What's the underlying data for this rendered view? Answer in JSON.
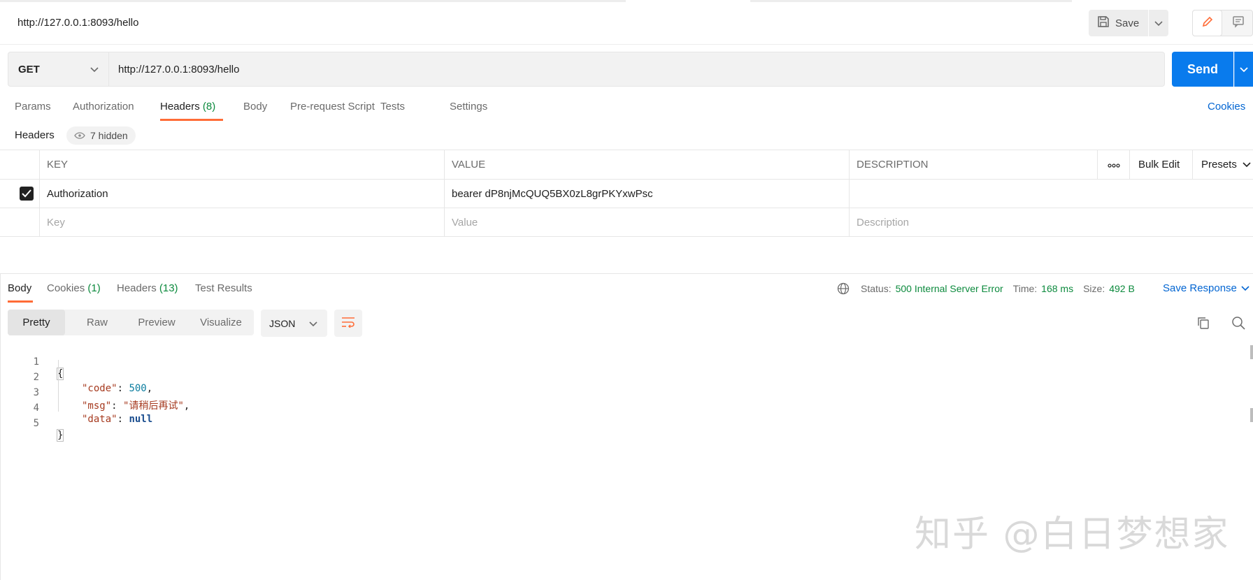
{
  "request": {
    "title": "http://127.0.0.1:8093/hello",
    "method": "GET",
    "url": "http://127.0.0.1:8093/hello"
  },
  "toolbar": {
    "save_label": "Save",
    "send_label": "Send"
  },
  "request_tabs": [
    {
      "label": "Params",
      "count": ""
    },
    {
      "label": "Authorization",
      "count": ""
    },
    {
      "label": "Headers",
      "count": "(8)"
    },
    {
      "label": "Body",
      "count": ""
    },
    {
      "label": "Pre-request Script",
      "count": ""
    },
    {
      "label": "Tests",
      "count": ""
    },
    {
      "label": "Settings",
      "count": ""
    }
  ],
  "cookies_link": "Cookies",
  "headers_section": {
    "label": "Headers",
    "hidden_text": "7 hidden",
    "columns": {
      "key": "KEY",
      "value": "VALUE",
      "description": "DESCRIPTION"
    },
    "bulk_edit": "Bulk Edit",
    "presets": "Presets",
    "rows": [
      {
        "checked": true,
        "key": "Authorization",
        "value": "bearer dP8njMcQUQ5BX0zL8grPKYxwPsc",
        "description": ""
      }
    ],
    "placeholders": {
      "key": "Key",
      "value": "Value",
      "description": "Description"
    }
  },
  "response_tabs": [
    {
      "label": "Body",
      "count": ""
    },
    {
      "label": "Cookies",
      "count": "(1)"
    },
    {
      "label": "Headers",
      "count": "(13)"
    },
    {
      "label": "Test Results",
      "count": ""
    }
  ],
  "response_meta": {
    "status_label": "Status:",
    "status_value": "500 Internal Server Error",
    "time_label": "Time:",
    "time_value": "168 ms",
    "size_label": "Size:",
    "size_value": "492 B",
    "save_response": "Save Response"
  },
  "format_tabs": [
    "Pretty",
    "Raw",
    "Preview",
    "Visualize"
  ],
  "language": "JSON",
  "code_lines": [
    {
      "num": "1",
      "open": "{"
    },
    {
      "num": "2",
      "key": "\"code\"",
      "value": "500",
      "type": "number",
      "trail": ","
    },
    {
      "num": "3",
      "key": "\"msg\"",
      "value": "\"请稍后再试\"",
      "type": "string",
      "trail": ","
    },
    {
      "num": "4",
      "key": "\"data\"",
      "value": "null",
      "type": "null",
      "trail": ""
    },
    {
      "num": "5",
      "close": "}"
    }
  ],
  "watermark": "知乎 @白日梦想家",
  "colors": {
    "accent_orange": "#ff6c37",
    "send_blue": "#097bed",
    "link_blue": "#0265d2",
    "status_green": "#0c8a3d"
  }
}
